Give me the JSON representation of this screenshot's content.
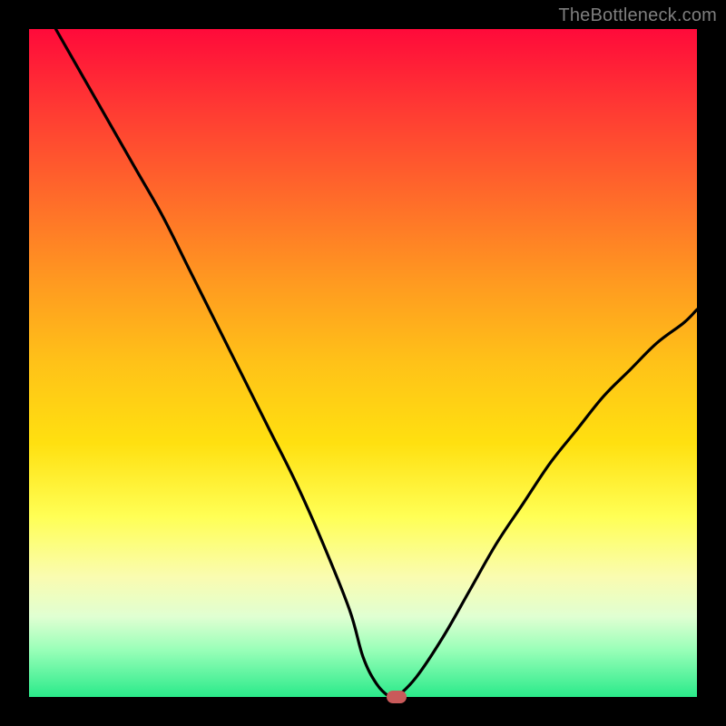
{
  "watermark": "TheBottleneck.com",
  "chart_data": {
    "type": "line",
    "title": "",
    "xlabel": "",
    "ylabel": "",
    "xlim": [
      0,
      100
    ],
    "ylim": [
      0,
      100
    ],
    "grid": false,
    "legend": false,
    "series": [
      {
        "name": "bottleneck-curve",
        "x": [
          4,
          8,
          12,
          16,
          20,
          24,
          28,
          32,
          36,
          40,
          44,
          48,
          50,
          52,
          54,
          55,
          58,
          62,
          66,
          70,
          74,
          78,
          82,
          86,
          90,
          94,
          98,
          100
        ],
        "y": [
          100,
          93,
          86,
          79,
          72,
          64,
          56,
          48,
          40,
          32,
          23,
          13,
          6,
          2,
          0,
          0,
          3,
          9,
          16,
          23,
          29,
          35,
          40,
          45,
          49,
          53,
          56,
          58
        ]
      }
    ],
    "marker": {
      "x": 55,
      "y": 0,
      "color": "#c95a5a"
    },
    "gradient_stops": [
      {
        "pos": 0,
        "color": "#ff0a3a"
      },
      {
        "pos": 12,
        "color": "#ff3a33"
      },
      {
        "pos": 25,
        "color": "#ff6a2a"
      },
      {
        "pos": 38,
        "color": "#ff9a20"
      },
      {
        "pos": 50,
        "color": "#ffc218"
      },
      {
        "pos": 62,
        "color": "#ffe010"
      },
      {
        "pos": 73,
        "color": "#ffff55"
      },
      {
        "pos": 82,
        "color": "#fafcb0"
      },
      {
        "pos": 88,
        "color": "#e0ffd2"
      },
      {
        "pos": 93,
        "color": "#98ffb8"
      },
      {
        "pos": 100,
        "color": "#2aea8a"
      }
    ]
  }
}
